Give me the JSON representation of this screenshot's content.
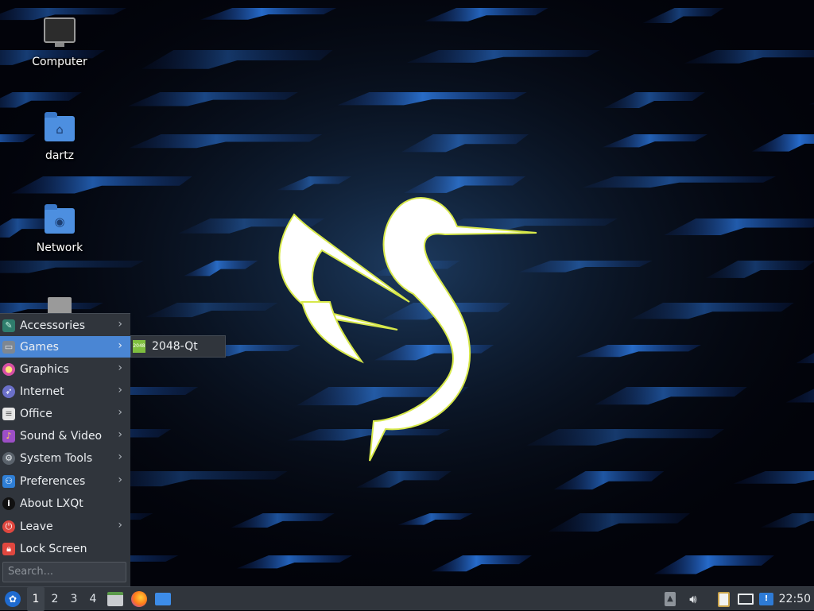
{
  "desktop": {
    "icons": [
      {
        "label": "Computer",
        "icon": "computer-icon"
      },
      {
        "label": "dartz",
        "icon": "home-folder-icon"
      },
      {
        "label": "Network",
        "icon": "network-folder-icon"
      },
      {
        "label": "",
        "icon": "trash-icon"
      }
    ]
  },
  "start_menu": {
    "items": [
      {
        "label": "Accessories",
        "icon": "accessories-icon",
        "submenu": true,
        "active": false
      },
      {
        "label": "Games",
        "icon": "games-icon",
        "submenu": true,
        "active": true
      },
      {
        "label": "Graphics",
        "icon": "graphics-icon",
        "submenu": true,
        "active": false
      },
      {
        "label": "Internet",
        "icon": "internet-icon",
        "submenu": true,
        "active": false
      },
      {
        "label": "Office",
        "icon": "office-icon",
        "submenu": true,
        "active": false
      },
      {
        "label": "Sound & Video",
        "icon": "sound-video-icon",
        "submenu": true,
        "active": false
      },
      {
        "label": "System Tools",
        "icon": "system-tools-icon",
        "submenu": true,
        "active": false
      },
      {
        "label": "Preferences",
        "icon": "preferences-icon",
        "submenu": true,
        "active": false
      },
      {
        "label": "About LXQt",
        "icon": "info-icon",
        "submenu": false,
        "active": false
      },
      {
        "label": "Leave",
        "icon": "power-icon",
        "submenu": true,
        "active": false
      },
      {
        "label": "Lock Screen",
        "icon": "lock-icon",
        "submenu": false,
        "active": false
      }
    ],
    "search_placeholder": "Search..."
  },
  "games_submenu": {
    "items": [
      {
        "label": "2048-Qt",
        "icon": "2048-game-icon",
        "icon_text": "2048"
      }
    ]
  },
  "taskbar": {
    "desktops": [
      "1",
      "2",
      "3",
      "4"
    ],
    "active_desktop": "1",
    "quicklaunch": [
      "file-manager-icon",
      "firefox-icon",
      "show-desktop-icon"
    ],
    "tray": [
      "removable-media-icon",
      "volume-icon",
      "clipboard-icon",
      "network-icon",
      "update-notifier-icon"
    ],
    "clock": "22:50"
  },
  "colors": {
    "panel": "#30353c",
    "highlight": "#4a86d4",
    "wallpaper_bg": "#02030a",
    "wallpaper_streak": "#1f6ee0",
    "logo_fill": "#ffffff",
    "logo_outline": "#d7e84a"
  }
}
